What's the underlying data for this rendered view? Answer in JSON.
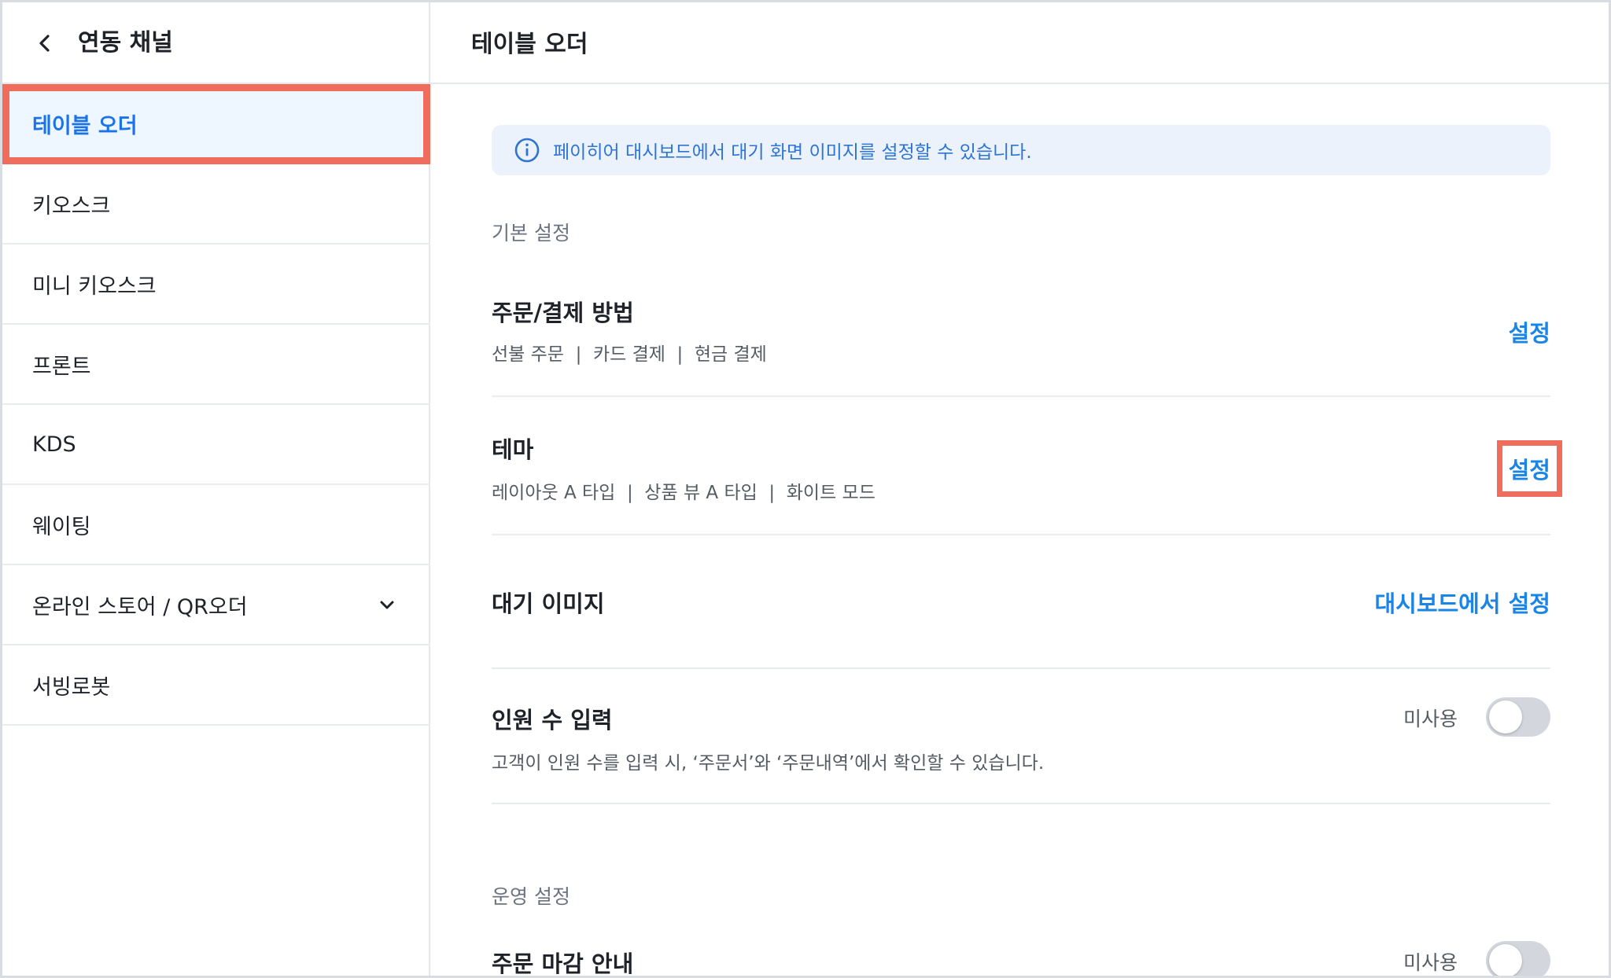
{
  "sidebar": {
    "title": "연동 채널",
    "items": [
      {
        "label": "테이블 오더"
      },
      {
        "label": "키오스크"
      },
      {
        "label": "미니 키오스크"
      },
      {
        "label": "프론트"
      },
      {
        "label": "KDS"
      },
      {
        "label": "웨이팅"
      },
      {
        "label": "온라인 스토어 / QR오더"
      },
      {
        "label": "서빙로봇"
      }
    ]
  },
  "main": {
    "title": "테이블 오더",
    "info_text": "페이히어 대시보드에서 대기 화면 이미지를 설정할 수 있습니다.",
    "basic_section": "기본 설정",
    "order_payment": {
      "title": "주문/결제 방법",
      "subtitle": "선불 주문  |  카드 결제  |  현금 결제",
      "action": "설정"
    },
    "theme": {
      "title": "테마",
      "subtitle": "레이아웃 A 타입  |  상품 뷰 A 타입  |  화이트 모드",
      "action": "설정"
    },
    "standby_image": {
      "title": "대기 이미지",
      "action": "대시보드에서 설정"
    },
    "party_size": {
      "title": "인원 수 입력",
      "subtitle": "고객이 인원 수를 입력 시, ‘주문서’와 ‘주문내역’에서 확인할 수 있습니다.",
      "status": "미사용",
      "enabled": false
    },
    "operation_section": "운영 설정",
    "order_close": {
      "title": "주문 마감 안내",
      "status": "미사용",
      "enabled": false
    }
  },
  "colors": {
    "accent": "#1a85e6",
    "active_bg": "#eef6ff",
    "highlight": "#f06c5d",
    "info_bg": "#ebf2fc"
  }
}
